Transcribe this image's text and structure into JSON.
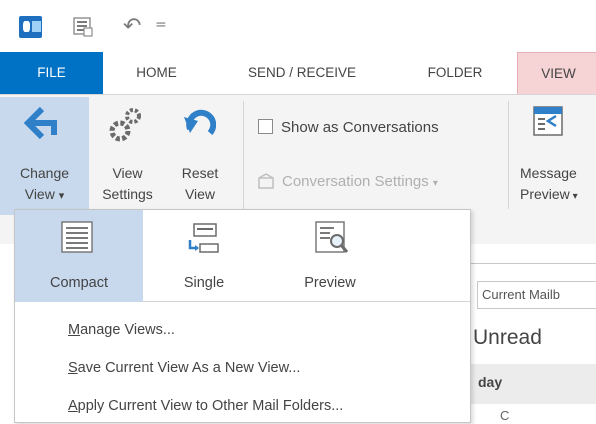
{
  "qat": {
    "icons": [
      "outlook-icon",
      "send-receive-icon",
      "undo-icon",
      "customize-icon"
    ],
    "customize_glyph": "="
  },
  "tabs": {
    "file": "FILE",
    "home": "HOME",
    "send_receive": "SEND / RECEIVE",
    "folder": "FOLDER",
    "view": "VIEW"
  },
  "ribbon": {
    "change_view": {
      "line1": "Change",
      "line2": "View",
      "arrow": "▾"
    },
    "view_settings": {
      "line1": "View",
      "line2": "Settings"
    },
    "reset_view": {
      "line1": "Reset",
      "line2": "View"
    },
    "show_as_conversations": "Show as Conversations",
    "conversation_settings": "Conversation Settings",
    "conversation_settings_arrow": "▾",
    "message_preview": {
      "line1": "Message",
      "line2": "Preview"
    }
  },
  "change_view_menu": {
    "gallery": [
      {
        "label": "Compact",
        "selected": true
      },
      {
        "label": "Single",
        "selected": false
      },
      {
        "label": "Preview",
        "selected": false
      }
    ],
    "items": [
      {
        "accel": "M",
        "rest": "anage Views..."
      },
      {
        "accel": "S",
        "rest": "ave Current View As a New View..."
      },
      {
        "accel": "A",
        "rest": "pply Current View to Other Mail Folders..."
      }
    ]
  },
  "background": {
    "search_scope": "Current Mailb",
    "unread": "Unread",
    "today": "day",
    "partial": "C"
  },
  "colors": {
    "file_tab": "#0072c6",
    "view_tab": "#f6d3d5",
    "selected": "#c8d9ee",
    "ribbon": "#f4f4f4"
  }
}
